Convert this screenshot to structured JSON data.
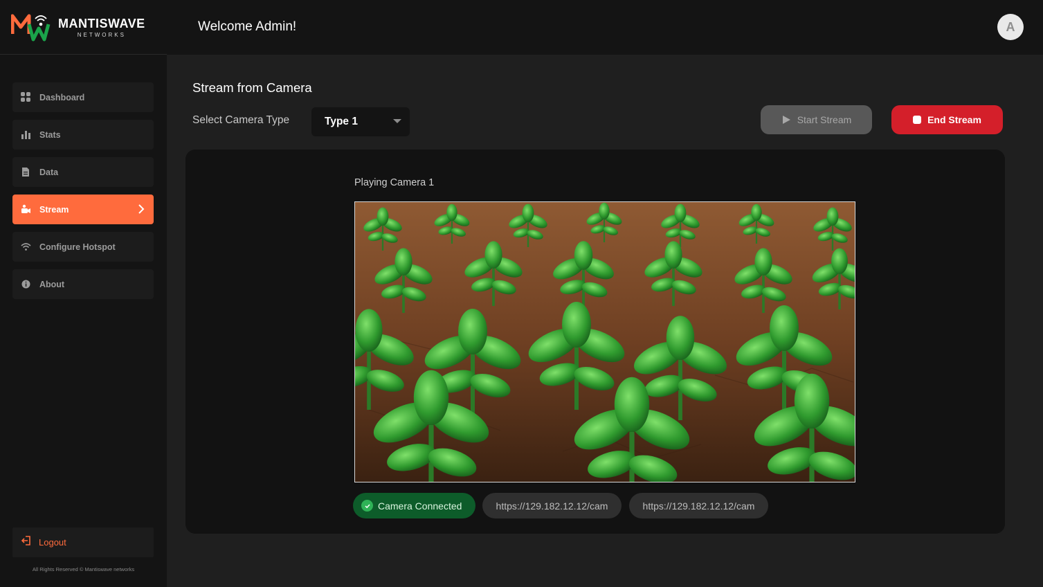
{
  "brand": {
    "name": "MANTISWAVE",
    "sub": "NETWORKS",
    "colors": {
      "orange": "#ff6b3d",
      "green": "#1aa34a",
      "red": "#d41f2a"
    }
  },
  "header": {
    "welcome": "Welcome Admin!",
    "avatar_initial": "A"
  },
  "sidebar": {
    "items": [
      {
        "label": "Dashboard",
        "icon": "grid-icon",
        "active": false
      },
      {
        "label": "Stats",
        "icon": "bar-chart-icon",
        "active": false
      },
      {
        "label": "Data",
        "icon": "document-icon",
        "active": false
      },
      {
        "label": "Stream",
        "icon": "camera-icon",
        "active": true
      },
      {
        "label": "Configure Hotspot",
        "icon": "wifi-icon",
        "active": false
      },
      {
        "label": "About",
        "icon": "info-icon",
        "active": false
      }
    ],
    "logout": "Logout",
    "copyright": "All Rights Reserved © Mantiswave networks"
  },
  "main": {
    "title": "Stream from Camera",
    "select_label": "Select Camera Type",
    "select_value": "Type 1",
    "start_button": "Start Stream",
    "end_button": "End Stream",
    "playing": "Playing Camera 1",
    "video_content": "camera feed of green seedlings in brown soil",
    "status": "Camera Connected",
    "url_1": "https://129.182.12.12/cam",
    "url_2": "https://129.182.12.12/cam"
  }
}
